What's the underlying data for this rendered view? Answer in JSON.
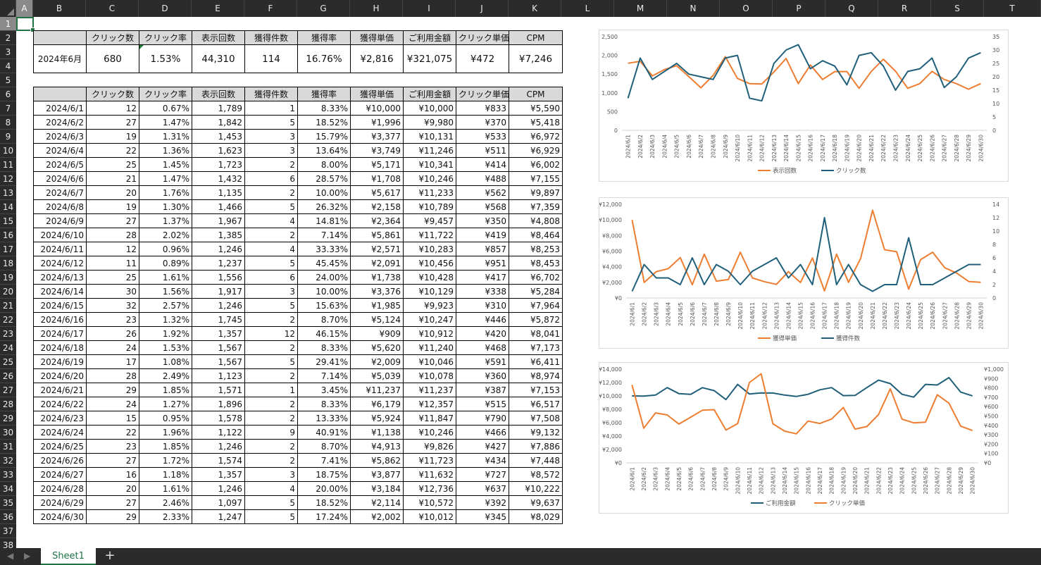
{
  "sheet": {
    "columns": [
      "A",
      "B",
      "C",
      "D",
      "E",
      "F",
      "G",
      "H",
      "I",
      "J",
      "K",
      "L",
      "M",
      "N",
      "O",
      "P",
      "Q",
      "R",
      "S",
      "T"
    ],
    "rows": [
      "1",
      "2",
      "3",
      "4",
      "5",
      "6",
      "7",
      "8",
      "9",
      "10",
      "11",
      "12",
      "13",
      "14",
      "15",
      "16",
      "17",
      "18",
      "19",
      "20",
      "21",
      "22",
      "23",
      "24",
      "25",
      "26",
      "27",
      "28",
      "29",
      "30",
      "31",
      "32",
      "33",
      "34",
      "35",
      "36",
      "37",
      "38"
    ],
    "selected_column": "A",
    "selected_row": "1",
    "tab_name": "Sheet1",
    "add_tab": "+",
    "nav_prev": "◀",
    "nav_next": "▶"
  },
  "summary": {
    "headers": [
      "",
      "クリック数",
      "クリック率",
      "表示回数",
      "獲得件数",
      "獲得率",
      "獲得単価",
      "ご利用金額",
      "クリック単価",
      "CPM"
    ],
    "values": [
      "2024年6月",
      "680",
      "1.53%",
      "44,310",
      "114",
      "16.76%",
      "¥2,816",
      "¥321,075",
      "¥472",
      "¥7,246"
    ]
  },
  "table": {
    "headers": [
      "",
      "クリック数",
      "クリック率",
      "表示回数",
      "獲得件数",
      "獲得率",
      "獲得単価",
      "ご利用金額",
      "クリック単価",
      "CPM"
    ],
    "rows": [
      [
        "2024/6/1",
        "12",
        "0.67%",
        "1,789",
        "1",
        "8.33%",
        "¥10,000",
        "¥10,000",
        "¥833",
        "¥5,590"
      ],
      [
        "2024/6/2",
        "27",
        "1.47%",
        "1,842",
        "5",
        "18.52%",
        "¥1,996",
        "¥9,980",
        "¥370",
        "¥5,418"
      ],
      [
        "2024/6/3",
        "19",
        "1.31%",
        "1,453",
        "3",
        "15.79%",
        "¥3,377",
        "¥10,131",
        "¥533",
        "¥6,972"
      ],
      [
        "2024/6/4",
        "22",
        "1.36%",
        "1,623",
        "3",
        "13.64%",
        "¥3,749",
        "¥11,246",
        "¥511",
        "¥6,929"
      ],
      [
        "2024/6/5",
        "25",
        "1.45%",
        "1,723",
        "2",
        "8.00%",
        "¥5,171",
        "¥10,341",
        "¥414",
        "¥6,002"
      ],
      [
        "2024/6/6",
        "21",
        "1.47%",
        "1,432",
        "6",
        "28.57%",
        "¥1,708",
        "¥10,246",
        "¥488",
        "¥7,155"
      ],
      [
        "2024/6/7",
        "20",
        "1.76%",
        "1,135",
        "2",
        "10.00%",
        "¥5,617",
        "¥11,233",
        "¥562",
        "¥9,897"
      ],
      [
        "2024/6/8",
        "19",
        "1.30%",
        "1,466",
        "5",
        "26.32%",
        "¥2,158",
        "¥10,789",
        "¥568",
        "¥7,359"
      ],
      [
        "2024/6/9",
        "27",
        "1.37%",
        "1,967",
        "4",
        "14.81%",
        "¥2,364",
        "¥9,457",
        "¥350",
        "¥4,808"
      ],
      [
        "2024/6/10",
        "28",
        "2.02%",
        "1,385",
        "2",
        "7.14%",
        "¥5,861",
        "¥11,722",
        "¥419",
        "¥8,464"
      ],
      [
        "2024/6/11",
        "12",
        "0.96%",
        "1,246",
        "4",
        "33.33%",
        "¥2,571",
        "¥10,283",
        "¥857",
        "¥8,253"
      ],
      [
        "2024/6/12",
        "11",
        "0.89%",
        "1,237",
        "5",
        "45.45%",
        "¥2,091",
        "¥10,456",
        "¥951",
        "¥8,453"
      ],
      [
        "2024/6/13",
        "25",
        "1.61%",
        "1,556",
        "6",
        "24.00%",
        "¥1,738",
        "¥10,428",
        "¥417",
        "¥6,702"
      ],
      [
        "2024/6/14",
        "30",
        "1.56%",
        "1,917",
        "3",
        "10.00%",
        "¥3,376",
        "¥10,129",
        "¥338",
        "¥5,284"
      ],
      [
        "2024/6/15",
        "32",
        "2.57%",
        "1,246",
        "5",
        "15.63%",
        "¥1,985",
        "¥9,923",
        "¥310",
        "¥7,964"
      ],
      [
        "2024/6/16",
        "23",
        "1.32%",
        "1,745",
        "2",
        "8.70%",
        "¥5,124",
        "¥10,247",
        "¥446",
        "¥5,872"
      ],
      [
        "2024/6/17",
        "26",
        "1.92%",
        "1,357",
        "12",
        "46.15%",
        "¥909",
        "¥10,912",
        "¥420",
        "¥8,041"
      ],
      [
        "2024/6/18",
        "24",
        "1.53%",
        "1,567",
        "2",
        "8.33%",
        "¥5,620",
        "¥11,240",
        "¥468",
        "¥7,173"
      ],
      [
        "2024/6/19",
        "17",
        "1.08%",
        "1,567",
        "5",
        "29.41%",
        "¥2,009",
        "¥10,046",
        "¥591",
        "¥6,411"
      ],
      [
        "2024/6/20",
        "28",
        "2.49%",
        "1,123",
        "2",
        "7.14%",
        "¥5,039",
        "¥10,078",
        "¥360",
        "¥8,974"
      ],
      [
        "2024/6/21",
        "29",
        "1.85%",
        "1,571",
        "1",
        "3.45%",
        "¥11,237",
        "¥11,237",
        "¥387",
        "¥7,153"
      ],
      [
        "2024/6/22",
        "24",
        "1.27%",
        "1,896",
        "2",
        "8.33%",
        "¥6,179",
        "¥12,357",
        "¥515",
        "¥6,517"
      ],
      [
        "2024/6/23",
        "15",
        "0.95%",
        "1,578",
        "2",
        "13.33%",
        "¥5,924",
        "¥11,847",
        "¥790",
        "¥7,508"
      ],
      [
        "2024/6/24",
        "22",
        "1.96%",
        "1,122",
        "9",
        "40.91%",
        "¥1,138",
        "¥10,246",
        "¥466",
        "¥9,132"
      ],
      [
        "2024/6/25",
        "23",
        "1.85%",
        "1,246",
        "2",
        "8.70%",
        "¥4,913",
        "¥9,826",
        "¥427",
        "¥7,886"
      ],
      [
        "2024/6/26",
        "27",
        "1.72%",
        "1,574",
        "2",
        "7.41%",
        "¥5,862",
        "¥11,723",
        "¥434",
        "¥7,448"
      ],
      [
        "2024/6/27",
        "16",
        "1.18%",
        "1,357",
        "3",
        "18.75%",
        "¥3,877",
        "¥11,632",
        "¥727",
        "¥8,572"
      ],
      [
        "2024/6/28",
        "20",
        "1.61%",
        "1,246",
        "4",
        "20.00%",
        "¥3,184",
        "¥12,736",
        "¥637",
        "¥10,222"
      ],
      [
        "2024/6/29",
        "27",
        "2.46%",
        "1,097",
        "5",
        "18.52%",
        "¥2,114",
        "¥10,572",
        "¥392",
        "¥9,637"
      ],
      [
        "2024/6/30",
        "29",
        "2.33%",
        "1,247",
        "5",
        "17.24%",
        "¥2,002",
        "¥10,012",
        "¥345",
        "¥8,029"
      ]
    ]
  },
  "colors": {
    "orange": "#ed7d31",
    "teal": "#1f5f7a",
    "header_bg": "#d9d9d9",
    "excel_green": "#217346"
  },
  "chart_data": [
    {
      "type": "line",
      "x": [
        "2024/6/1",
        "2024/6/2",
        "2024/6/3",
        "2024/6/4",
        "2024/6/5",
        "2024/6/6",
        "2024/6/7",
        "2024/6/8",
        "2024/6/9",
        "2024/6/10",
        "2024/6/11",
        "2024/6/12",
        "2024/6/13",
        "2024/6/14",
        "2024/6/15",
        "2024/6/16",
        "2024/6/17",
        "2024/6/18",
        "2024/6/19",
        "2024/6/20",
        "2024/6/21",
        "2024/6/22",
        "2024/6/23",
        "2024/6/24",
        "2024/6/25",
        "2024/6/26",
        "2024/6/27",
        "2024/6/28",
        "2024/6/29",
        "2024/6/30"
      ],
      "series": [
        {
          "name": "表示回数",
          "axis": "left",
          "color": "#ed7d31",
          "values": [
            1789,
            1842,
            1453,
            1623,
            1723,
            1432,
            1135,
            1466,
            1967,
            1385,
            1246,
            1237,
            1556,
            1917,
            1246,
            1745,
            1357,
            1567,
            1567,
            1123,
            1571,
            1896,
            1578,
            1122,
            1246,
            1574,
            1357,
            1246,
            1097,
            1247
          ]
        },
        {
          "name": "クリック数",
          "axis": "right",
          "color": "#1f5f7a",
          "values": [
            12,
            27,
            19,
            22,
            25,
            21,
            20,
            19,
            27,
            28,
            12,
            11,
            25,
            30,
            32,
            23,
            26,
            24,
            17,
            28,
            29,
            24,
            15,
            22,
            23,
            27,
            16,
            20,
            27,
            29
          ]
        }
      ],
      "ylim_left": [
        0,
        2500
      ],
      "ylim_right": [
        0,
        35
      ],
      "yticks_left": [
        "0",
        "500",
        "1,000",
        "1,500",
        "2,000",
        "2,500"
      ],
      "yticks_right": [
        "0",
        "5",
        "10",
        "15",
        "20",
        "25",
        "30",
        "35"
      ],
      "legend": "bottom"
    },
    {
      "type": "line",
      "x": [
        "2024/6/1",
        "2024/6/2",
        "2024/6/3",
        "2024/6/4",
        "2024/6/5",
        "2024/6/6",
        "2024/6/7",
        "2024/6/8",
        "2024/6/9",
        "2024/6/10",
        "2024/6/11",
        "2024/6/12",
        "2024/6/13",
        "2024/6/14",
        "2024/6/15",
        "2024/6/16",
        "2024/6/17",
        "2024/6/18",
        "2024/6/19",
        "2024/6/20",
        "2024/6/21",
        "2024/6/22",
        "2024/6/23",
        "2024/6/24",
        "2024/6/25",
        "2024/6/26",
        "2024/6/27",
        "2024/6/28",
        "2024/6/29",
        "2024/6/30"
      ],
      "series": [
        {
          "name": "獲得単価",
          "axis": "left",
          "color": "#ed7d31",
          "values": [
            10000,
            1996,
            3377,
            3749,
            5171,
            1708,
            5617,
            2158,
            2364,
            5861,
            2571,
            2091,
            1738,
            3376,
            1985,
            5124,
            909,
            5620,
            2009,
            5039,
            11237,
            6179,
            5924,
            1138,
            4913,
            5862,
            3877,
            3184,
            2114,
            2002
          ]
        },
        {
          "name": "獲得件数",
          "axis": "right",
          "color": "#1f5f7a",
          "values": [
            1,
            5,
            3,
            3,
            2,
            6,
            2,
            5,
            4,
            2,
            4,
            5,
            6,
            3,
            5,
            2,
            12,
            2,
            5,
            2,
            1,
            2,
            2,
            9,
            2,
            2,
            3,
            4,
            5,
            5
          ]
        }
      ],
      "ylim_left": [
        0,
        12000
      ],
      "ylim_right": [
        0,
        14
      ],
      "yticks_left": [
        "¥0",
        "¥2,000",
        "¥4,000",
        "¥6,000",
        "¥8,000",
        "¥10,000",
        "¥12,000"
      ],
      "yticks_right": [
        "0",
        "2",
        "4",
        "6",
        "8",
        "10",
        "12",
        "14"
      ],
      "legend": "bottom"
    },
    {
      "type": "line",
      "x": [
        "2024/6/1",
        "2024/6/2",
        "2024/6/3",
        "2024/6/4",
        "2024/6/5",
        "2024/6/6",
        "2024/6/7",
        "2024/6/8",
        "2024/6/9",
        "2024/6/10",
        "2024/6/11",
        "2024/6/12",
        "2024/6/13",
        "2024/6/14",
        "2024/6/15",
        "2024/6/16",
        "2024/6/17",
        "2024/6/18",
        "2024/6/19",
        "2024/6/20",
        "2024/6/21",
        "2024/6/22",
        "2024/6/23",
        "2024/6/24",
        "2024/6/25",
        "2024/6/26",
        "2024/6/27",
        "2024/6/28",
        "2024/6/29",
        "2024/6/30"
      ],
      "series": [
        {
          "name": "ご利用金額",
          "axis": "left",
          "color": "#1f5f7a",
          "values": [
            10000,
            9980,
            10131,
            11246,
            10341,
            10246,
            11233,
            10789,
            9457,
            11722,
            10283,
            10456,
            10428,
            10129,
            9923,
            10247,
            10912,
            11240,
            10046,
            10078,
            11237,
            12357,
            11847,
            10246,
            9826,
            11723,
            11632,
            12736,
            10572,
            10012
          ]
        },
        {
          "name": "クリック単価",
          "axis": "right",
          "color": "#ed7d31",
          "values": [
            833,
            370,
            533,
            511,
            414,
            488,
            562,
            568,
            350,
            419,
            857,
            951,
            417,
            338,
            310,
            446,
            420,
            468,
            591,
            360,
            387,
            515,
            790,
            466,
            427,
            434,
            727,
            637,
            392,
            345
          ]
        }
      ],
      "ylim_left": [
        0,
        14000
      ],
      "ylim_right": [
        0,
        1000
      ],
      "yticks_left": [
        "¥0",
        "¥2,000",
        "¥4,000",
        "¥6,000",
        "¥8,000",
        "¥10,000",
        "¥12,000",
        "¥14,000"
      ],
      "yticks_right": [
        "¥0",
        "¥100",
        "¥200",
        "¥300",
        "¥400",
        "¥500",
        "¥600",
        "¥700",
        "¥800",
        "¥900",
        "¥1,000"
      ],
      "legend_order": [
        "ご利用金額",
        "クリック単価"
      ],
      "legend": "bottom"
    }
  ]
}
